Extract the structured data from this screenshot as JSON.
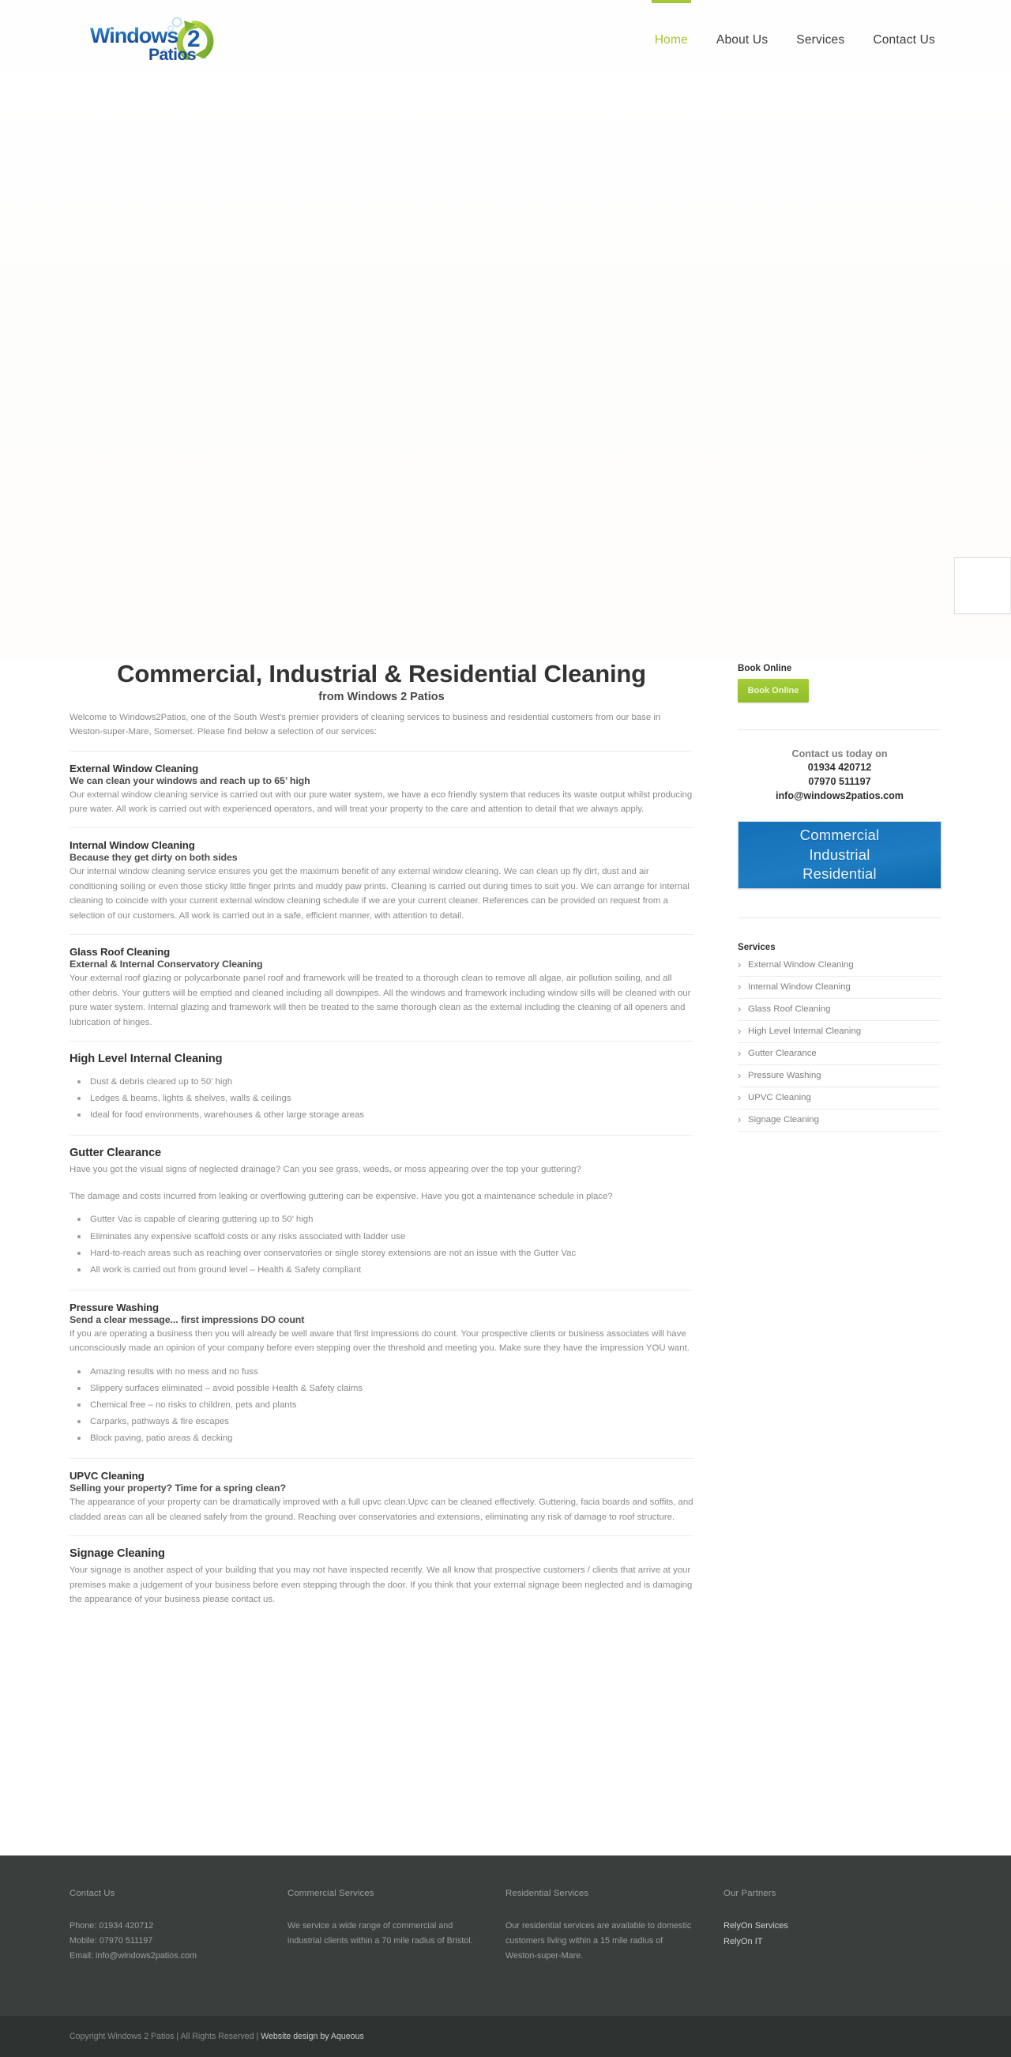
{
  "brand": {
    "logo_text_primary": "Windows",
    "logo_text_number": "2",
    "logo_text_secondary": "Patios",
    "accent_green": "#a4c639",
    "accent_blue": "#1a76bd"
  },
  "nav": {
    "items": [
      {
        "label": "Home",
        "active": true
      },
      {
        "label": "About Us",
        "active": false
      },
      {
        "label": "Services",
        "active": false
      },
      {
        "label": "Contact Us",
        "active": false
      }
    ]
  },
  "main": {
    "title": "Commercial, Industrial & Residential Cleaning",
    "subtitle": "from Windows 2 Patios",
    "intro": "Welcome to Windows2Patios, one of the South West's premier providers of cleaning services to business and residential customers from our base in Weston-super-Mare, Somerset. Please find below a selection of our services:",
    "sections": [
      {
        "title": "External Window Cleaning",
        "subtitle": "We can clean your windows and reach up to 65’ high",
        "paragraphs": [
          "Our external window cleaning service is carried out with our pure water system, we have a eco friendly system that reduces its waste output whilst producing pure water. All work is carried out with experienced operators, and will treat your property to the care and attention to detail that we always apply."
        ],
        "bullets": []
      },
      {
        "title": "Internal Window Cleaning",
        "subtitle": "Because they get dirty on both sides",
        "paragraphs": [
          "Our internal window cleaning service ensures you get the maximum benefit of any external window cleaning. We can clean up fly dirt, dust and air conditioning soiling or even those sticky little finger prints and muddy paw prints. Cleaning is carried out during times to suit you. We can arrange for internal cleaning to coincide with your current external window cleaning schedule if we are your current cleaner. References can be provided on request from a selection of our customers. All work is carried out in a safe, efficient manner, with attention to detail."
        ],
        "bullets": []
      },
      {
        "title": "Glass Roof Cleaning",
        "subtitle": "External & Internal Conservatory Cleaning",
        "paragraphs": [
          "Your external roof glazing or polycarbonate panel roof and framework will be treated to a thorough clean to remove all algae, air pollution soiling, and all other debris. Your gutters will be emptied and cleaned including all downpipes. All the windows and framework including window sills will be cleaned with our pure water system. Internal glazing and framework will then be treated to the same thorough clean as the external including the cleaning of all openers and lubrication of hinges."
        ],
        "bullets": []
      },
      {
        "title": "High Level Internal Cleaning",
        "subtitle": "",
        "paragraphs": [],
        "bullets": [
          "Dust & debris cleared up to 50’ high",
          "Ledges & beams, lights & shelves, walls & ceilings",
          "Ideal for food environments, warehouses & other large storage areas"
        ]
      },
      {
        "title": "Gutter Clearance",
        "subtitle": "",
        "paragraphs": [
          "Have you got the visual signs of neglected drainage? Can you see grass, weeds, or moss appearing over the top your guttering?",
          "The damage and costs incurred from leaking or overflowing guttering can be expensive. Have you got a maintenance schedule in place?"
        ],
        "bullets": [
          "Gutter Vac is capable of clearing guttering up to 50’ high",
          "Eliminates any expensive scaffold costs or any risks associated with ladder use",
          "Hard-to-reach areas such as reaching over conservatories or single storey extensions are not an issue with the Gutter Vac",
          "All work is carried out from ground level – Health & Safety compliant"
        ]
      },
      {
        "title": "Pressure Washing",
        "subtitle": "Send a clear message... first impressions DO count",
        "paragraphs": [
          "If you are operating a business then you will already be well aware that first impressions do count. Your prospective clients or business associates will have unconsciously made an opinion of your company before even stepping over the threshold and meeting you. Make sure they have the impression YOU want."
        ],
        "bullets": [
          "Amazing results with no mess and no fuss",
          "Slippery surfaces eliminated – avoid possible Health & Safety claims",
          "Chemical free – no risks to children, pets and plants",
          "Carparks, pathways & fire escapes",
          "Block paving, patio areas & decking"
        ]
      },
      {
        "title": "UPVC Cleaning",
        "subtitle": "Selling your property? Time for a spring clean?",
        "paragraphs": [
          "The appearance of your property can be dramatically improved with a full upvc clean.Upvc can be cleaned effectively. Guttering, facia boards and soffits, and cladded areas can all be cleaned safely from the ground. Reaching over conservatories and extensions, eliminating  any risk of damage to roof structure."
        ],
        "bullets": []
      },
      {
        "title": "Signage Cleaning",
        "subtitle": "",
        "paragraphs": [
          "Your signage is another aspect of your building that you may not have inspected recently. We all know that prospective customers / clients that arrive at your premises make a judgement of your business before even stepping through the door. If you think that  your external signage been neglected and is damaging the appearance of your business please contact us."
        ],
        "bullets": []
      }
    ]
  },
  "sidebar": {
    "book_online_heading": "Book Online",
    "book_online_button": "Book Online",
    "contact_lead": "Contact us today on",
    "contact_phone": "01934 420712",
    "contact_mobile": "07970 511197",
    "contact_email": "info@windows2patios.com",
    "banner_line1": "Commercial",
    "banner_line2": "Industrial",
    "banner_line3": "Residential",
    "services_heading": "Services",
    "services": [
      "External Window Cleaning",
      "Internal Window Cleaning",
      "Glass Roof Cleaning",
      "High Level Internal Cleaning",
      "Gutter Clearance",
      "Pressure Washing",
      "UPVC Cleaning",
      "Signage Cleaning"
    ]
  },
  "footer": {
    "col1_title": "Contact Us",
    "col1_phone_label": "Phone:",
    "col1_phone": "01934 420712",
    "col1_mobile_label": "Mobile:",
    "col1_mobile": "07970 511197",
    "col1_email_label": "Email:",
    "col1_email": "info@windows2patios.com",
    "col2_title": "Commercial Services",
    "col2_text": "We service a wide range of commercial and industrial clients within a 70 mile radius of Bristol.",
    "col3_title": "Residential Services",
    "col3_text": "Our residential services are available to domestic customers living within a 15 mile radius of Weston-super-Mare.",
    "col4_title": "Our Partners",
    "partners": [
      "RelyOn Services",
      "RelyOn IT"
    ],
    "copyright": "Copyright Windows 2 Patios | All Rights Reserved | ",
    "credit": "Website design by Aqueous"
  }
}
